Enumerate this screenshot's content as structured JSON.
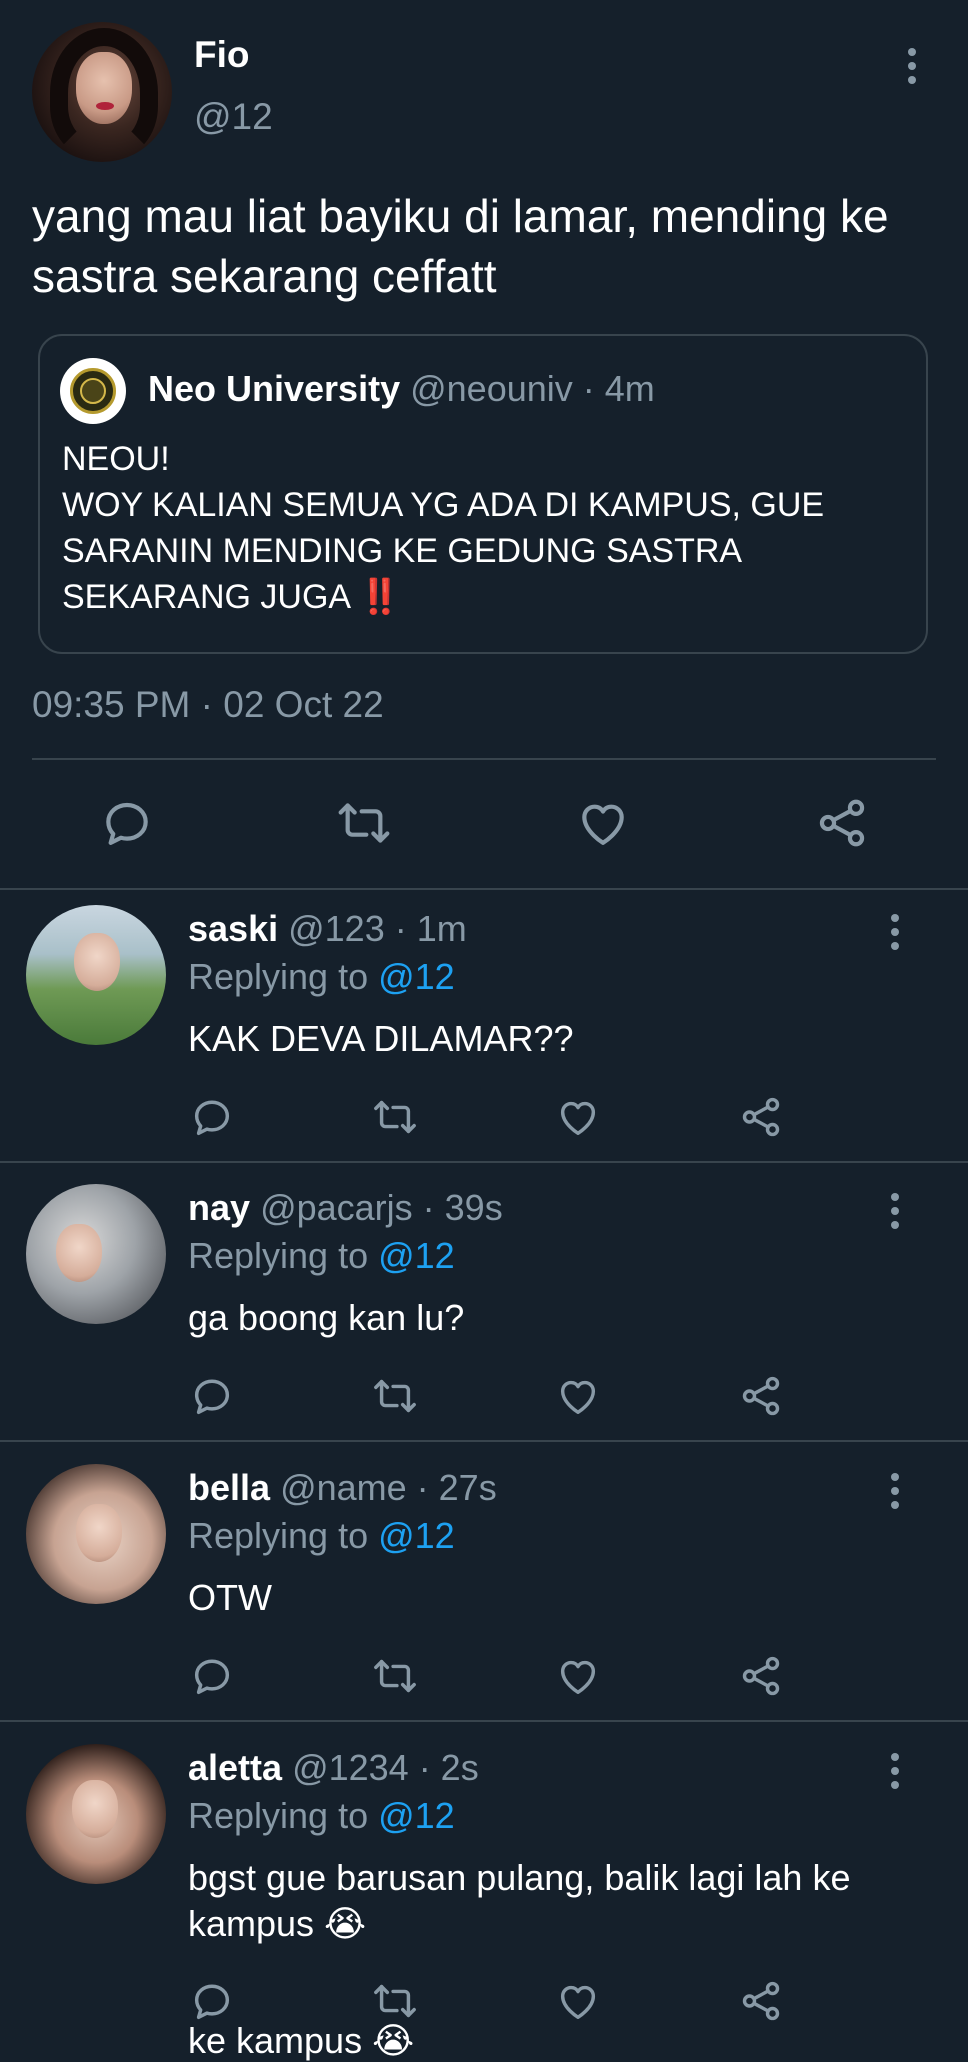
{
  "tweet": {
    "name": "Fio",
    "handle": "@12",
    "text": "yang mau liat bayiku di lamar, mending ke sastra sekarang ceffatt",
    "timestamp": "09:35 PM · 02 Oct 22"
  },
  "quote": {
    "name": "Neo University",
    "meta": "@neouniv · 4m",
    "lines": [
      "NEOU!",
      "WOY KALIAN SEMUA YG ADA DI KAMPUS, GUE SARANIN MENDING KE GEDUNG SASTRA SEKARANG JUGA"
    ],
    "emoji": "‼️"
  },
  "replies": [
    {
      "name": "saski",
      "meta": "@123 · 1m",
      "replying_prefix": "Replying to ",
      "replying_to": "@12",
      "text": "KAK DEVA DILAMAR??"
    },
    {
      "name": "nay",
      "meta": "@pacarjs · 39s",
      "replying_prefix": "Replying to ",
      "replying_to": "@12",
      "text": "ga boong kan lu?"
    },
    {
      "name": "bella",
      "meta": "@name · 27s",
      "replying_prefix": "Replying to ",
      "replying_to": "@12",
      "text": "OTW"
    },
    {
      "name": "aletta",
      "meta": "@1234 · 2s",
      "replying_prefix": "Replying to ",
      "replying_to": "@12",
      "text": "bgst gue barusan pulang, balik lagi lah ke kampus 😭"
    }
  ],
  "overflow_text": "ke kampus 😭",
  "colors": {
    "background": "#15202b",
    "secondary_text": "#8899a6",
    "mention": "#1da1f2",
    "border": "#38444d"
  },
  "icons": [
    "comment-icon",
    "retweet-icon",
    "like-icon",
    "share-icon",
    "more-options-icon"
  ]
}
